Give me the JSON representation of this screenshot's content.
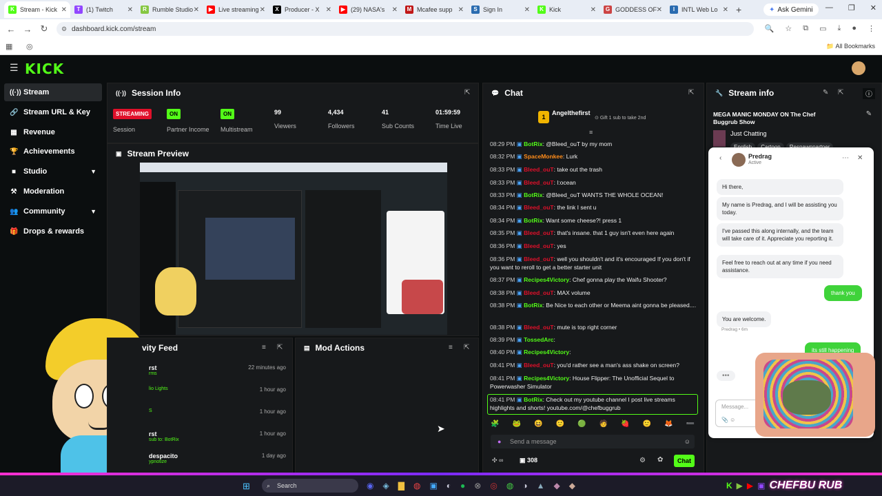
{
  "browser": {
    "tabs": [
      {
        "label": "Stream - Kick",
        "fav": "K",
        "color": "#53fc18"
      },
      {
        "label": "(1) Twitch",
        "fav": "T",
        "color": "#9146ff"
      },
      {
        "label": "Rumble Studio",
        "fav": "R",
        "color": "#85c742"
      },
      {
        "label": "Live streaming",
        "fav": "▶",
        "color": "#ff0000"
      },
      {
        "label": "Producer - X",
        "fav": "X",
        "color": "#000000"
      },
      {
        "label": "(29) NASA's",
        "fav": "▶",
        "color": "#ff0000"
      },
      {
        "label": "Mcafee supp",
        "fav": "M",
        "color": "#c01818"
      },
      {
        "label": "Sign In",
        "fav": "S",
        "color": "#2b6cb0"
      },
      {
        "label": "Kick",
        "fav": "K",
        "color": "#53fc18"
      },
      {
        "label": "GODDESS OF",
        "fav": "G",
        "color": "#c44"
      },
      {
        "label": "INTL Web Lo",
        "fav": "I",
        "color": "#2b6cb0"
      }
    ],
    "ask_gemini": "Ask Gemini",
    "url": "dashboard.kick.com/stream",
    "all_bookmarks": "All Bookmarks"
  },
  "header": {
    "logo": "KICK"
  },
  "sidebar": {
    "items": [
      {
        "label": "Stream",
        "icon": "broadcast-icon",
        "glyph": "((·))"
      },
      {
        "label": "Stream URL & Key",
        "icon": "link-icon",
        "glyph": "🔗"
      },
      {
        "label": "Revenue",
        "icon": "revenue-icon",
        "glyph": "▦"
      },
      {
        "label": "Achievements",
        "icon": "trophy-icon",
        "glyph": "🏆"
      },
      {
        "label": "Studio",
        "icon": "camera-icon",
        "glyph": "■"
      },
      {
        "label": "Moderation",
        "icon": "hammer-icon",
        "glyph": "⚒"
      },
      {
        "label": "Community",
        "icon": "people-icon",
        "glyph": "👥"
      },
      {
        "label": "Drops & rewards",
        "icon": "gift-icon",
        "glyph": "🎁"
      }
    ]
  },
  "session": {
    "title": "Session Info",
    "stats": [
      {
        "value": "STREAMING",
        "label": "Session",
        "badge_color": "#e0102a"
      },
      {
        "value": "ON",
        "label": "Partner Income",
        "badge_color": "#53fc18"
      },
      {
        "value": "ON",
        "label": "Multistream",
        "badge_color": "#53fc18"
      },
      {
        "value": "99",
        "label": "Viewers"
      },
      {
        "value": "4,434",
        "label": "Followers"
      },
      {
        "value": "41",
        "label": "Sub Counts"
      },
      {
        "value": "01:59:59",
        "label": "Time Live"
      }
    ]
  },
  "preview": {
    "title": "Stream Preview"
  },
  "activity": {
    "title": "vity Feed",
    "rows": [
      {
        "name": "rst",
        "sub": "rms",
        "time": "22 minutes ago"
      },
      {
        "name": "",
        "sub": "lio Lights",
        "time": "1 hour ago"
      },
      {
        "name": "",
        "sub": "S",
        "time": "1 hour ago"
      },
      {
        "name": "rst",
        "sub": "sub to: BotRix",
        "time": "1 hour ago"
      },
      {
        "name": "despacito",
        "sub": "ypnotize",
        "time": "1 day ago"
      }
    ]
  },
  "mod_actions": {
    "title": "Mod Actions"
  },
  "chat": {
    "title": "Chat",
    "pinned_user": "Angelthefirst",
    "pinned_rank": "1",
    "pinned_text": "Gift 1 sub to take 2nd",
    "messages": [
      {
        "time": "08:29 PM",
        "user": "BotRix",
        "color": "#53fc18",
        "text": "@Bleed_ouT by my mom"
      },
      {
        "time": "08:32 PM",
        "user": "SpaceMonkee",
        "color": "#ff8c1a",
        "text": "Lurk"
      },
      {
        "time": "08:33 PM",
        "user": "Bleed_ouT",
        "color": "#e0102a",
        "text": "take out the trash"
      },
      {
        "time": "08:33 PM",
        "user": "Bleed_ouT",
        "color": "#e0102a",
        "text": "l:ocean"
      },
      {
        "time": "08:33 PM",
        "user": "BotRix",
        "color": "#53fc18",
        "text": "@Bleed_ouT WANTS THE WHOLE OCEAN!"
      },
      {
        "time": "08:34 PM",
        "user": "Bleed_ouT",
        "color": "#e0102a",
        "text": "the link I sent u"
      },
      {
        "time": "08:34 PM",
        "user": "BotRix",
        "color": "#53fc18",
        "text": "Want some cheese?! press 1"
      },
      {
        "time": "08:35 PM",
        "user": "Bleed_ouT",
        "color": "#e0102a",
        "text": "that's insane. that 1 guy isn't even here again"
      },
      {
        "time": "08:36 PM",
        "user": "Bleed_ouT",
        "color": "#e0102a",
        "text": "yes"
      },
      {
        "time": "08:36 PM",
        "user": "Bleed_ouT",
        "color": "#e0102a",
        "text": "well you shouldn't and it's encouraged If you don't if you want to reroll to get a better starter unit"
      },
      {
        "time": "08:37 PM",
        "user": "Recipes4Victory",
        "color": "#53fc18",
        "text": "Chef gonna play the Waifu Shooter?"
      },
      {
        "time": "08:38 PM",
        "user": "Bleed_ouT",
        "color": "#e0102a",
        "text": "MAX volume"
      },
      {
        "time": "08:38 PM",
        "user": "BotRix",
        "color": "#53fc18",
        "text": "Be Nice to each other or Meema aint gonna be pleased...."
      },
      {
        "time": "08:38 PM",
        "user": "Bleed_ouT",
        "color": "#e0102a",
        "text": "mute is top right corner"
      },
      {
        "time": "08:39 PM",
        "user": "TossedArc",
        "color": "#53fc18",
        "text": ""
      },
      {
        "time": "08:40 PM",
        "user": "Recipes4Victory",
        "color": "#53fc18",
        "text": ""
      },
      {
        "time": "08:41 PM",
        "user": "Bleed_ouT",
        "color": "#e0102a",
        "text": "you'd rather see a man's ass shake on screen?"
      },
      {
        "time": "08:41 PM",
        "user": "Recipes4Victory",
        "color": "#53fc18",
        "text": "House Flipper: The Unofficial Sequel to Powerwasher Simulator"
      },
      {
        "time": "08:41 PM",
        "user": "BotRix",
        "color": "#53fc18",
        "text": "Check out my youtube channel I post live streams highlights and shorts! youtube.com/@chefbuggrub"
      }
    ],
    "input_placeholder": "Send a message",
    "points": "308",
    "send_label": "Chat"
  },
  "stream_info": {
    "title": "Stream info",
    "stream_title": "MEGA MANIC MONDAY ON The Chef Buggrub Show",
    "category": "Just Chatting",
    "tags": [
      "English",
      "Cartoon",
      "Respawnpartner"
    ]
  },
  "support": {
    "agent_name": "Predrag",
    "agent_status": "Active",
    "messages": [
      {
        "text": "Hi there,"
      },
      {
        "text": "My name is Predrag, and I will be assisting you today."
      },
      {
        "text": "I've passed this along internally, and the team will take care of it. Appreciate you reporting it."
      },
      {
        "text": "Feel free to reach out at any time if you need assistance."
      }
    ],
    "user_reply": "thank you",
    "agent_reply": "You are welcome.",
    "agent_meta": "Predrag • 6m",
    "user_reply2": "its still happening",
    "typing": "•••",
    "input_placeholder": "Message..."
  },
  "taskbar": {
    "search_placeholder": "Search",
    "brand": "CHEFBU RUB"
  }
}
